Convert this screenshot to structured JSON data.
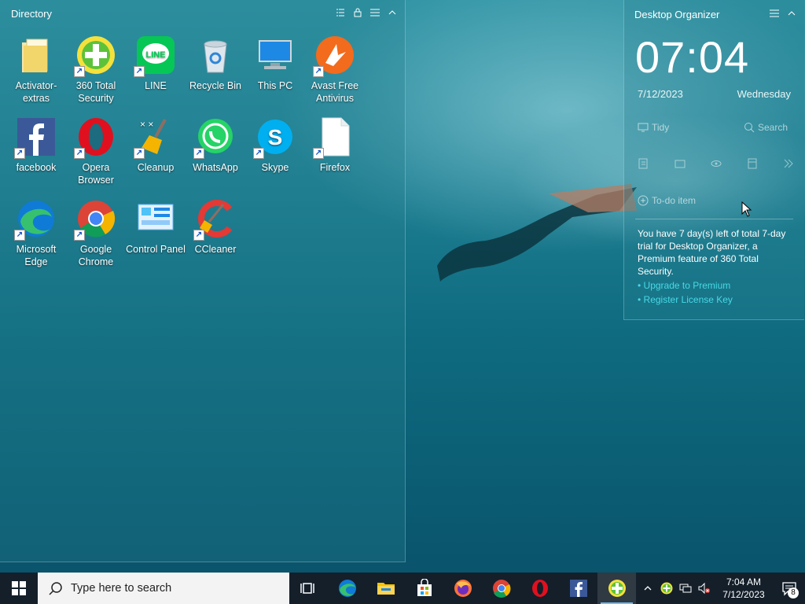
{
  "directory": {
    "title": "Directory",
    "tools": [
      "list-view-icon",
      "lock-icon",
      "menu-icon",
      "collapse-icon"
    ],
    "icons": [
      {
        "label": "Activator-extras",
        "icon": "folder-icon",
        "shortcut": false
      },
      {
        "label": "360 Total Security",
        "icon": "360-total-security-icon",
        "shortcut": true
      },
      {
        "label": "LINE",
        "icon": "line-icon",
        "shortcut": true
      },
      {
        "label": "Recycle Bin",
        "icon": "recycle-bin-icon",
        "shortcut": false
      },
      {
        "label": "This PC",
        "icon": "this-pc-icon",
        "shortcut": false
      },
      {
        "label": "Avast Free Antivirus",
        "icon": "avast-icon",
        "shortcut": true
      },
      {
        "label": "facebook",
        "icon": "facebook-icon",
        "shortcut": true
      },
      {
        "label": "Opera Browser",
        "icon": "opera-icon",
        "shortcut": true
      },
      {
        "label": "Cleanup",
        "icon": "cleanup-icon",
        "shortcut": true
      },
      {
        "label": "WhatsApp",
        "icon": "whatsapp-icon",
        "shortcut": true
      },
      {
        "label": "Skype",
        "icon": "skype-icon",
        "shortcut": true
      },
      {
        "label": "Firefox",
        "icon": "file-icon",
        "shortcut": true
      },
      {
        "label": "Microsoft Edge",
        "icon": "edge-icon",
        "shortcut": true
      },
      {
        "label": "Google Chrome",
        "icon": "chrome-icon",
        "shortcut": true
      },
      {
        "label": "Control Panel",
        "icon": "control-panel-icon",
        "shortcut": false
      },
      {
        "label": "CCleaner",
        "icon": "ccleaner-icon",
        "shortcut": true
      }
    ]
  },
  "organizer": {
    "title": "Desktop Organizer",
    "time": "07:04",
    "date": "7/12/2023",
    "weekday": "Wednesday",
    "tidy_label": "Tidy",
    "search_label": "Search",
    "todo_label": "To-do item",
    "trial_text": "You have 7 day(s) left of total 7-day trial for Desktop Organizer, a Premium feature of 360 Total Security.",
    "upgrade_link": "• Upgrade to Premium",
    "register_link": "• Register License Key"
  },
  "taskbar": {
    "search_placeholder": "Type here to search",
    "apps": [
      "task-view-icon",
      "edge-icon",
      "file-explorer-icon",
      "store-icon",
      "firefox-icon",
      "chrome-icon",
      "opera-icon",
      "facebook-icon",
      "360-total-security-icon"
    ],
    "clock_time": "7:04 AM",
    "clock_date": "7/12/2023",
    "notification_count": "8"
  },
  "colors": {
    "accent_link": "#47d9e6",
    "taskbar": "#141f2a"
  }
}
